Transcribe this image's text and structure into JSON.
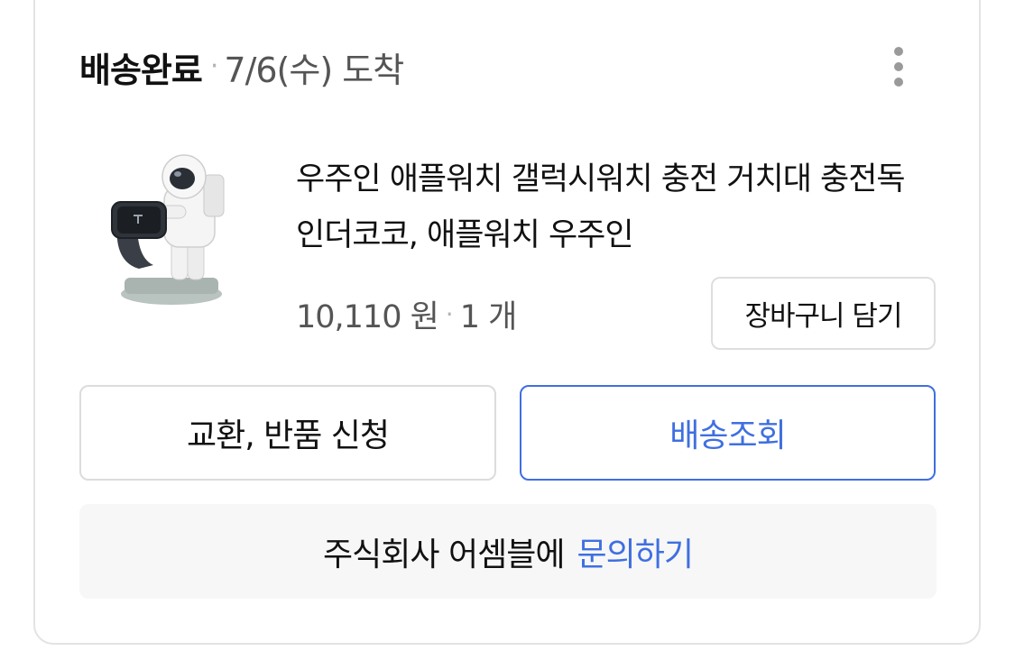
{
  "order": {
    "status": "배송완료",
    "separator": "·",
    "arrival": "7/6(수) 도착",
    "more_icon": "more-vertical-icon"
  },
  "product": {
    "image_icon": "astronaut-watch-stand-image",
    "title": "우주인 애플워치 갤럭시워치 충전 거치대 충전독 인더코코, 애플워치 우주인",
    "price": "10,110 원",
    "quantity": "1 개",
    "separator": "·",
    "cart_label": "장바구니 담기"
  },
  "actions": {
    "exchange_return_label": "교환, 반품 신청",
    "tracking_label": "배송조회"
  },
  "inquiry": {
    "prefix": "주식회사 어셈블에",
    "link_label": "문의하기"
  },
  "colors": {
    "accent_blue": "#3f6fe0",
    "muted_text": "#555555",
    "border_gray": "#dcdcdc",
    "inquiry_bg": "#f7f7f7"
  }
}
